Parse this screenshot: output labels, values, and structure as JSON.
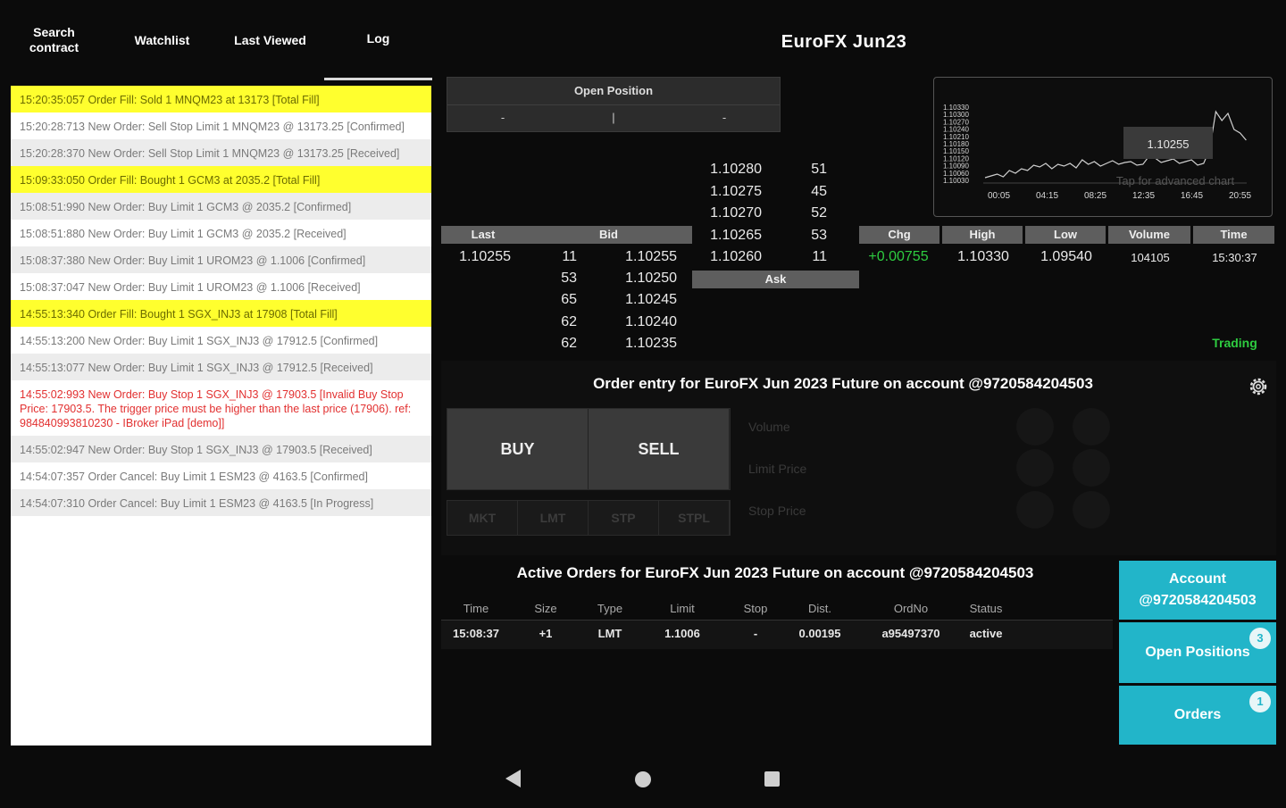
{
  "tabs": [
    {
      "label": "Search\ncontract"
    },
    {
      "label": "Watchlist"
    },
    {
      "label": "Last Viewed"
    },
    {
      "label": "Log"
    }
  ],
  "log": [
    {
      "text": "15:20:35:057 Order Fill: Sold 1 MNQM23 at 13173 [Total Fill]",
      "kind": "fill"
    },
    {
      "text": "15:20:28:713 New Order: Sell Stop Limit 1 MNQM23 @ 13173.25 [Confirmed]",
      "kind": "white"
    },
    {
      "text": "15:20:28:370 New Order: Sell Stop Limit 1 MNQM23 @ 13173.25 [Received]",
      "kind": "alt"
    },
    {
      "text": "15:09:33:050 Order Fill: Bought 1 GCM3 at 2035.2 [Total Fill]",
      "kind": "fill"
    },
    {
      "text": "15:08:51:990 New Order: Buy Limit 1 GCM3 @ 2035.2 [Confirmed]",
      "kind": "alt"
    },
    {
      "text": "15:08:51:880 New Order: Buy Limit 1 GCM3 @ 2035.2 [Received]",
      "kind": "white"
    },
    {
      "text": "15:08:37:380 New Order: Buy Limit 1 UROM23 @ 1.1006 [Confirmed]",
      "kind": "alt"
    },
    {
      "text": "15:08:37:047 New Order: Buy Limit 1 UROM23 @ 1.1006 [Received]",
      "kind": "white"
    },
    {
      "text": "14:55:13:340 Order Fill: Bought 1 SGX_INJ3 at 17908 [Total Fill]",
      "kind": "fill"
    },
    {
      "text": "14:55:13:200 New Order: Buy Limit 1 SGX_INJ3 @ 17912.5 [Confirmed]",
      "kind": "white"
    },
    {
      "text": "14:55:13:077 New Order: Buy Limit 1 SGX_INJ3 @ 17912.5 [Received]",
      "kind": "alt"
    },
    {
      "text": "14:55:02:993 New Order: Buy Stop 1 SGX_INJ3 @ 17903.5 [Invalid Buy Stop Price: 17903.5. The trigger price must be higher than the last price (17906). ref: 984840993810230 - IBroker iPad [demo]]",
      "kind": "err"
    },
    {
      "text": "14:55:02:947 New Order: Buy Stop 1 SGX_INJ3 @ 17903.5 [Received]",
      "kind": "alt"
    },
    {
      "text": "14:54:07:357 Order Cancel: Buy Limit 1 ESM23 @ 4163.5 [Confirmed]",
      "kind": "white"
    },
    {
      "text": "14:54:07:310 Order Cancel: Buy Limit 1 ESM23 @ 4163.5 [In Progress]",
      "kind": "alt"
    }
  ],
  "title": "EuroFX Jun23",
  "open_position": {
    "label": "Open Position",
    "values": [
      "-",
      "|",
      "-"
    ]
  },
  "mini_chart": {
    "y_ticks": [
      "1.10330",
      "1.10300",
      "1.10270",
      "1.10240",
      "1.10210",
      "1.10180",
      "1.10150",
      "1.10120",
      "1.10090",
      "1.10060",
      "1.10030"
    ],
    "x_ticks": [
      "00:05",
      "04:15",
      "08:25",
      "12:35",
      "16:45",
      "20:55"
    ],
    "price_label": "1.10255",
    "hint": "Tap for advanced chart"
  },
  "book": {
    "asks": [
      {
        "price": "1.10280",
        "size": "51"
      },
      {
        "price": "1.10275",
        "size": "45"
      },
      {
        "price": "1.10270",
        "size": "52"
      },
      {
        "price": "1.10265",
        "size": "53"
      },
      {
        "price": "1.10260",
        "size": "11"
      }
    ],
    "bids": [
      {
        "size": "11",
        "price": "1.10255"
      },
      {
        "size": "53",
        "price": "1.10250"
      },
      {
        "size": "65",
        "price": "1.10245"
      },
      {
        "size": "62",
        "price": "1.10240"
      },
      {
        "size": "62",
        "price": "1.10235"
      }
    ],
    "last_header": "Last",
    "bid_header": "Bid",
    "ask_header": "Ask",
    "last": "1.10255"
  },
  "stats": {
    "headers": [
      "Chg",
      "High",
      "Low",
      "Volume",
      "Time"
    ],
    "chg": "+0.00755",
    "high": "1.10330",
    "low": "1.09540",
    "volume": "104105",
    "time": "15:30:37",
    "status": "Trading"
  },
  "order_entry": {
    "title": "Order entry for EuroFX Jun 2023 Future on account @9720584204503",
    "buy": "BUY",
    "sell": "SELL",
    "types": [
      "MKT",
      "LMT",
      "STP",
      "STPL"
    ],
    "params": [
      "Volume",
      "Limit Price",
      "Stop Price"
    ]
  },
  "active_orders": {
    "title": "Active Orders for EuroFX Jun 2023 Future on account @9720584204503",
    "headers": [
      "Time",
      "Size",
      "Type",
      "Limit",
      "Stop",
      "Dist.",
      "OrdNo",
      "Status"
    ],
    "rows": [
      [
        "15:08:37",
        "+1",
        "LMT",
        "1.1006",
        "-",
        "0.00195",
        "a95497370",
        "active"
      ]
    ]
  },
  "side_buttons": {
    "account": "Account\n@9720584204503",
    "open_positions": "Open Positions",
    "open_positions_count": "3",
    "orders": "Orders",
    "orders_count": "1"
  },
  "colors": {
    "accent": "#22b5c9",
    "fill_highlight": "#ffff2e",
    "positive": "#2ecc40",
    "error": "#e23030"
  }
}
